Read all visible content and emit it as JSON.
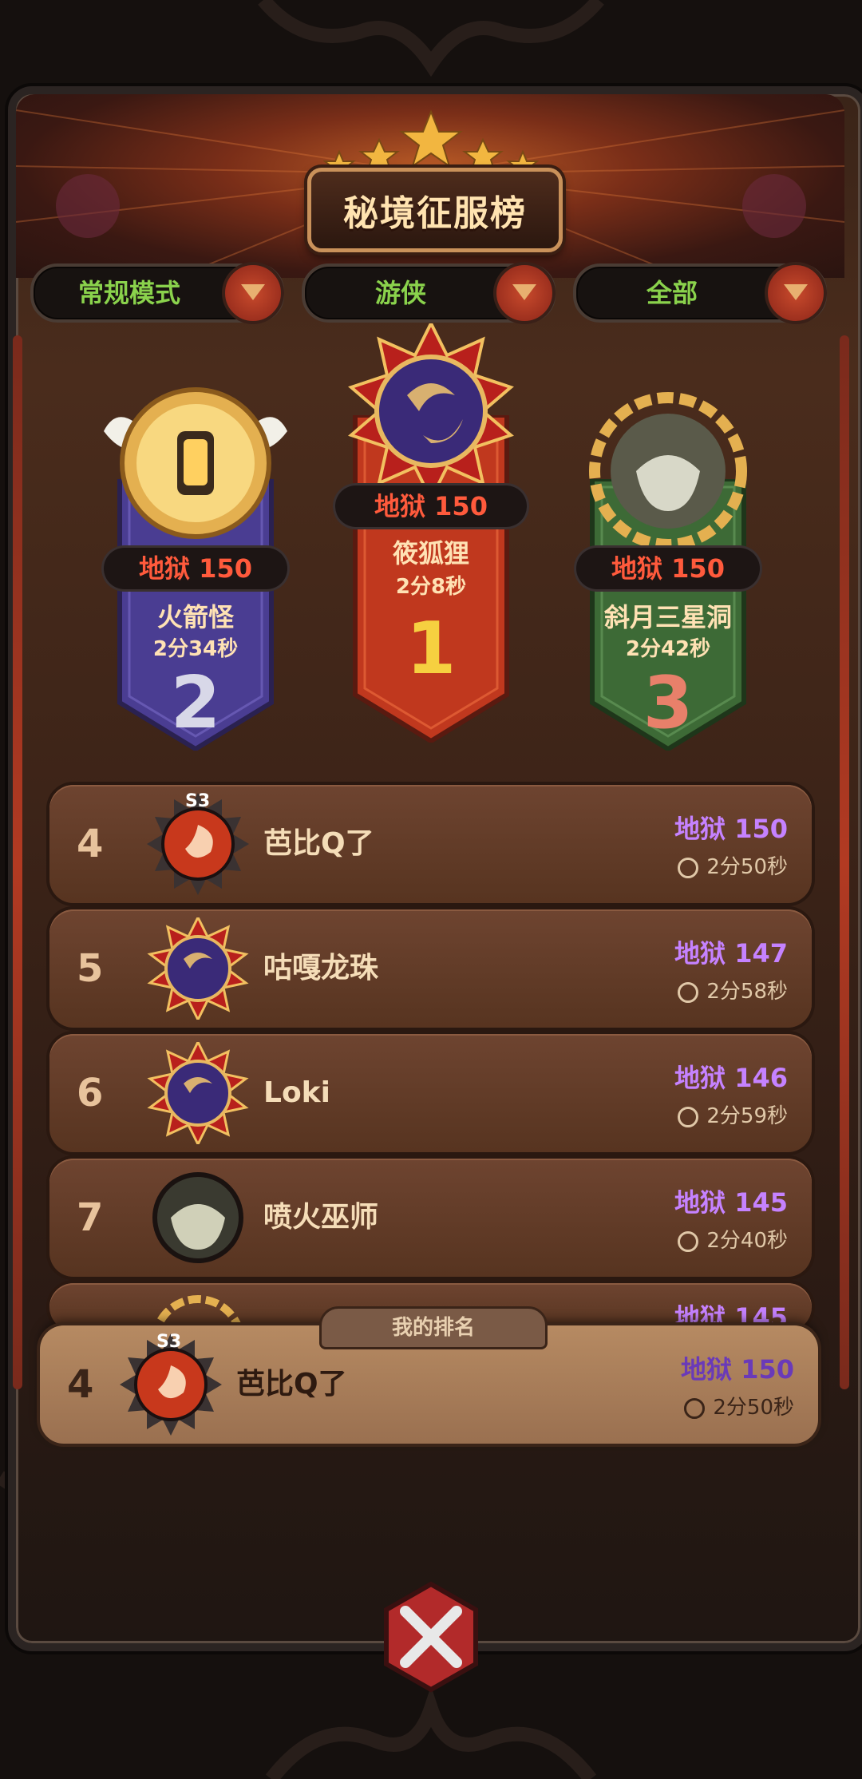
{
  "title": "秘境征服榜",
  "filters": [
    {
      "label": "常规模式"
    },
    {
      "label": "游侠"
    },
    {
      "label": "全部"
    }
  ],
  "podium": [
    {
      "place": "1",
      "difficulty": "地狱 150",
      "name": "筱狐狸",
      "time": "2分8秒",
      "color": "#c0381e"
    },
    {
      "place": "2",
      "difficulty": "地狱 150",
      "name": "火箭怪",
      "time": "2分34秒",
      "color": "#4a3d92"
    },
    {
      "place": "3",
      "difficulty": "地狱 150",
      "name": "斜月三星洞",
      "time": "2分42秒",
      "color": "#3d6a36"
    }
  ],
  "list": [
    {
      "rank": "4",
      "name": "芭比Q了",
      "score": "地狱 150",
      "time": "2分50秒",
      "badge": "S3",
      "avatar": "fire-swirl-icon"
    },
    {
      "rank": "5",
      "name": "咕嘎龙珠",
      "score": "地狱 147",
      "time": "2分58秒",
      "avatar": "moon-star-icon"
    },
    {
      "rank": "6",
      "name": "Loki",
      "score": "地狱 146",
      "time": "2分59秒",
      "avatar": "moon-star-icon"
    },
    {
      "rank": "7",
      "name": "喷火巫师",
      "score": "地狱 145",
      "time": "2分40秒",
      "avatar": "goblin-icon"
    },
    {
      "rank": "",
      "name": "",
      "score": "地狱 145",
      "time": "",
      "avatar": "chain-ring-icon"
    }
  ],
  "my_rank": {
    "label": "我的排名",
    "rank": "4",
    "name": "芭比Q了",
    "score": "地狱 150",
    "time": "2分50秒",
    "badge": "S3"
  }
}
